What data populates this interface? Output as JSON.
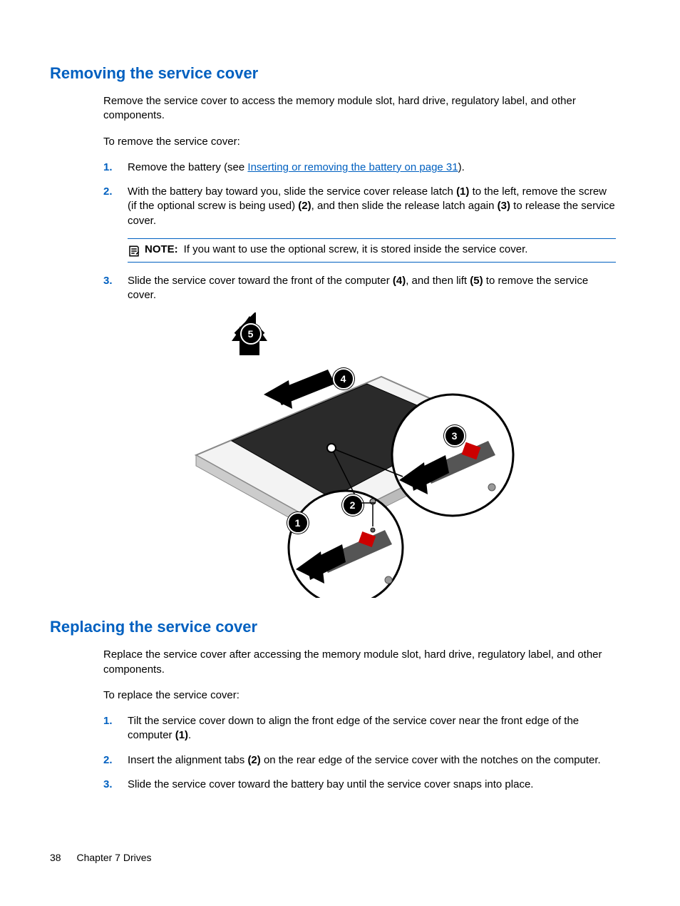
{
  "section1": {
    "heading": "Removing the service cover",
    "intro1": "Remove the service cover to access the memory module slot, hard drive, regulatory label, and other components.",
    "intro2": "To remove the service cover:",
    "steps": [
      {
        "num": "1.",
        "pre": "Remove the battery (see ",
        "link": "Inserting or removing the battery on page 31",
        "post": ")."
      },
      {
        "num": "2.",
        "t1": "With the battery bay toward you, slide the service cover release latch ",
        "b1": "(1)",
        "t2": " to the left, remove the screw (if the optional screw is being used) ",
        "b2": "(2)",
        "t3": ", and then slide the release latch again ",
        "b3": "(3)",
        "t4": " to release the service cover."
      },
      {
        "num": "3.",
        "t1": "Slide the service cover toward the front of the computer ",
        "b1": "(4)",
        "t2": ", and then lift ",
        "b2": "(5)",
        "t3": " to remove the service cover."
      }
    ],
    "note_label": "NOTE:",
    "note_text": "If you want to use the optional screw, it is stored inside the service cover."
  },
  "figure": {
    "callouts": [
      "1",
      "2",
      "3",
      "4",
      "5"
    ]
  },
  "section2": {
    "heading": "Replacing the service cover",
    "intro1": "Replace the service cover after accessing the memory module slot, hard drive, regulatory label, and other components.",
    "intro2": "To replace the service cover:",
    "steps": [
      {
        "num": "1.",
        "t1": "Tilt the service cover down to align the front edge of the service cover near the front edge of the computer ",
        "b1": "(1)",
        "t2": "."
      },
      {
        "num": "2.",
        "t1": "Insert the alignment tabs ",
        "b1": "(2)",
        "t2": " on the rear edge of the service cover with the notches on the computer."
      },
      {
        "num": "3.",
        "t1": "Slide the service cover toward the battery bay until the service cover snaps into place."
      }
    ]
  },
  "footer": {
    "page_number": "38",
    "chapter": "Chapter 7   Drives"
  }
}
